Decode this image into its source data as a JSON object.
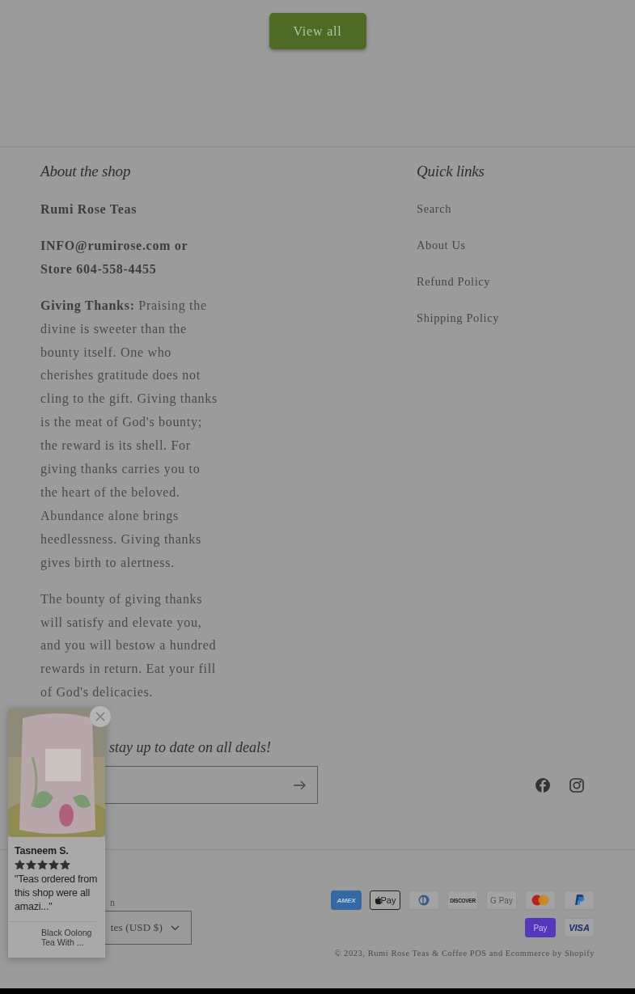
{
  "view_all_button": "View all",
  "about": {
    "heading": "About the shop",
    "paragraphs": [
      {
        "kind": "bold",
        "text": "Rumi Rose Teas"
      },
      {
        "kind": "bold",
        "text": "INFO@rumirose.com or Store 604-558-4455"
      },
      {
        "kind": "plain",
        "text": "**Giving Thanks:** Praising the divine is sweeter than the bounty itself. One who cherishes gratitude does not cling to the gift. Giving thanks is the meat of God's bounty; the reward is its shell. For giving thanks carries you to the heart of the beloved. Abundance alone brings heedlessness. Giving thanks gives birth to alertness."
      },
      {
        "kind": "plain",
        "text": "The bounty of giving thanks will satisfy and elevate you, and you will bestow a hundred rewards in return. Eat your fill of God's delicacies."
      }
    ]
  },
  "quick_links": {
    "heading": "Quick links",
    "links": [
      "Search",
      "About Us",
      "Refund Policy",
      "Shipping Policy"
    ]
  },
  "newsletter": {
    "heading": "stay up to date on all deals!"
  },
  "social": [
    {
      "kind": "facebook"
    },
    {
      "kind": "instagram"
    }
  ],
  "country": {
    "label": "n",
    "value": "tes (USD $)"
  },
  "payments": [
    {
      "kind": "amex",
      "label": "AMEX"
    },
    {
      "kind": "apple",
      "label": "Pay"
    },
    {
      "kind": "diners"
    },
    {
      "kind": "discover",
      "label": "DISCOVER"
    },
    {
      "kind": "google",
      "label": "G Pay"
    },
    {
      "kind": "mastercard"
    },
    {
      "kind": "paypal"
    },
    {
      "kind": "shop",
      "label": "Pay"
    },
    {
      "kind": "visa",
      "label": "VISA"
    }
  ],
  "copyright": "© 2023, Rumi Rose Teas & Coffee POS and Ecommerce by Shopify",
  "review_popup": {
    "name": "Tasneem S.",
    "stars": 5,
    "quote": "\"Teas ordered from this shop were all amazi...\"",
    "product": "Black Oolong Tea With ..."
  }
}
